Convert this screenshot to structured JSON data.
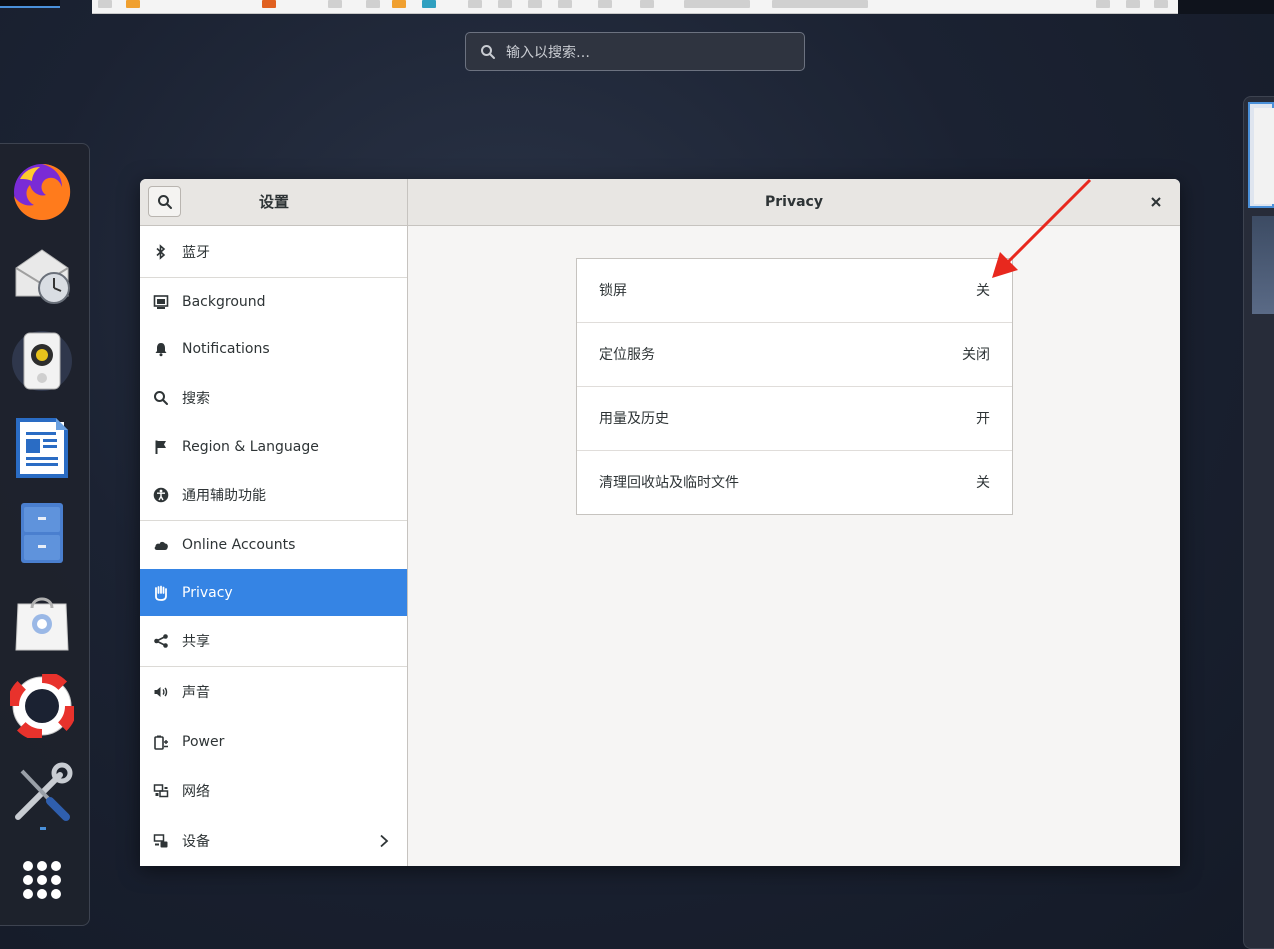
{
  "overview": {
    "search_placeholder": "输入以搜索…"
  },
  "dock": {
    "items": [
      {
        "name": "firefox-icon"
      },
      {
        "name": "evolution-mail-icon"
      },
      {
        "name": "rhythmbox-icon"
      },
      {
        "name": "libreoffice-writer-icon"
      },
      {
        "name": "files-icon"
      },
      {
        "name": "software-icon"
      },
      {
        "name": "help-icon"
      },
      {
        "name": "tools-icon"
      },
      {
        "name": "show-apps-icon"
      }
    ]
  },
  "settings": {
    "sidebar_title": "设置",
    "page_title": "Privacy",
    "sidebar": {
      "items": [
        {
          "label": "蓝牙",
          "icon": "bluetooth-icon"
        },
        {
          "label": "Background",
          "icon": "background-icon"
        },
        {
          "label": "Notifications",
          "icon": "bell-icon"
        },
        {
          "label": "搜索",
          "icon": "search-icon"
        },
        {
          "label": "Region & Language",
          "icon": "flag-icon"
        },
        {
          "label": "通用辅助功能",
          "icon": "accessibility-icon"
        },
        {
          "label": "Online Accounts",
          "icon": "cloud-icon"
        },
        {
          "label": "Privacy",
          "icon": "hand-icon",
          "active": true
        },
        {
          "label": "共享",
          "icon": "share-icon"
        },
        {
          "label": "声音",
          "icon": "speaker-icon"
        },
        {
          "label": "Power",
          "icon": "power-icon"
        },
        {
          "label": "网络",
          "icon": "network-icon"
        },
        {
          "label": "设备",
          "icon": "devices-icon"
        }
      ]
    },
    "privacy_rows": [
      {
        "label": "锁屏",
        "value": "关"
      },
      {
        "label": "定位服务",
        "value": "关闭"
      },
      {
        "label": "用量及历史",
        "value": "开"
      },
      {
        "label": "清理回收站及临时文件",
        "value": "关"
      }
    ]
  },
  "colors": {
    "accent": "#3584e4",
    "annotation_arrow": "#e8281e"
  }
}
